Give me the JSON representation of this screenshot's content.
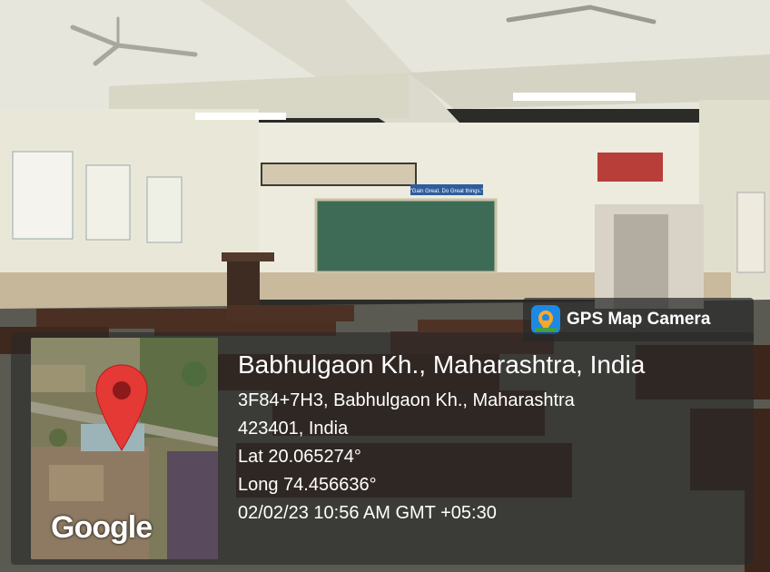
{
  "badge": {
    "label": "GPS Map Camera",
    "icon": "gps-camera-icon"
  },
  "board_sign": "\"Gain Great. Do Great things.\"",
  "location": {
    "title": "Babhulgaon Kh., Maharashtra, India",
    "address_line1": "3F84+7H3, Babhulgaon Kh., Maharashtra",
    "address_line2": "423401, India",
    "latitude": "Lat 20.065274°",
    "longitude": "Long 74.456636°",
    "timestamp": "02/02/23 10:56 AM GMT +05:30"
  },
  "map": {
    "attribution": "Google",
    "pin_icon": "map-pin-icon",
    "pin_color": "#e53935"
  },
  "colors": {
    "overlay": "#282828",
    "chalkboard": "#3e6b56",
    "wall": "#e8e7d8",
    "desk": "#4a2f22"
  }
}
